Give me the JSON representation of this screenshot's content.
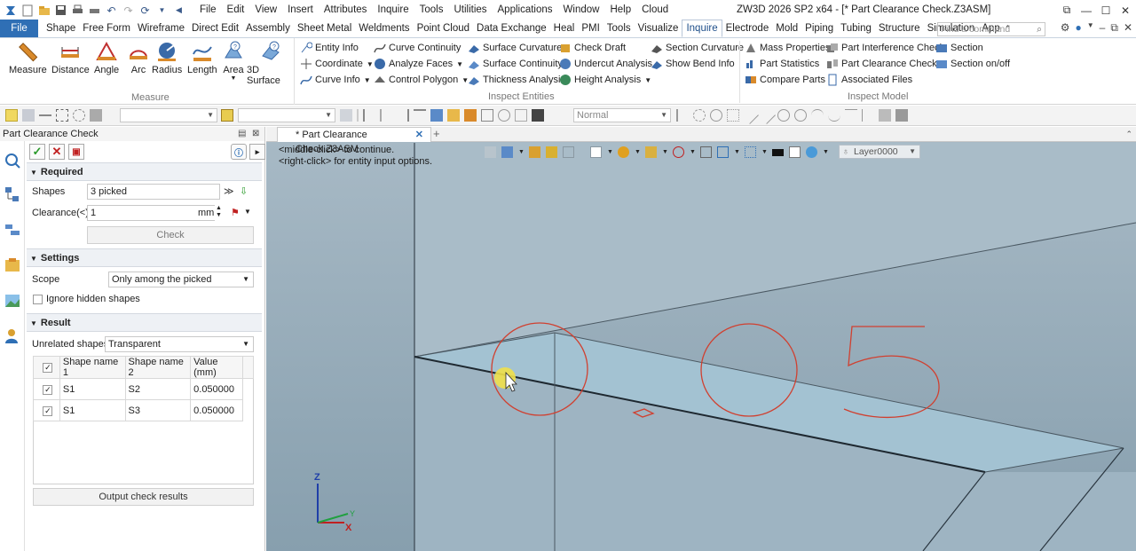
{
  "app": {
    "title": "ZW3D 2026 SP2 x64 - [* Part Clearance Check.Z3ASM]",
    "menu": [
      "File",
      "Edit",
      "View",
      "Insert",
      "Attributes",
      "Inquire",
      "Tools",
      "Utilities",
      "Applications",
      "Window",
      "Help",
      "Cloud"
    ]
  },
  "ribbon_tabs": [
    "Shape",
    "Free Form",
    "Wireframe",
    "Direct Edit",
    "Assembly",
    "Sheet Metal",
    "Weldments",
    "Point Cloud",
    "Data Exchange",
    "Heal",
    "PMI",
    "Tools",
    "Visualize",
    "Inquire",
    "Electrode",
    "Mold",
    "Piping",
    "Tubing",
    "Structure",
    "Simulation",
    "App"
  ],
  "file_tab": "File",
  "active_tab": "Inquire",
  "search": {
    "placeholder": "Find a command"
  },
  "measure_group": {
    "label": "Measure",
    "buttons": [
      "Measure",
      "Distance",
      "Angle",
      "Arc",
      "Radius",
      "Length",
      "Area",
      "3D Surface"
    ]
  },
  "inspect_entities": {
    "label": "Inspect Entities",
    "col1": [
      "Entity Info",
      "Coordinate",
      "Curve Info"
    ],
    "col2": [
      "Curve Continuity",
      "Analyze Faces",
      "Control Polygon"
    ],
    "col3": [
      "Surface Curvature",
      "Surface Continuity",
      "Thickness Analysis"
    ],
    "col4": [
      "Check Draft",
      "Undercut Analysis",
      "Height Analysis"
    ],
    "col5": [
      "Section Curvature",
      "Show Bend Info"
    ]
  },
  "inspect_model": {
    "label": "Inspect Model",
    "col1": [
      "Mass Properties",
      "Part Statistics",
      "Compare Parts"
    ],
    "col2": [
      "Part Interference Check",
      "Part Clearance Check",
      "Associated Files"
    ],
    "col3": [
      "Section",
      "Section on/off"
    ]
  },
  "toolbar": {
    "style_combo": "Normal"
  },
  "panel": {
    "title": "Part Clearance Check",
    "required": {
      "header": "Required",
      "shapes_label": "Shapes",
      "shapes_value": "3 picked",
      "clearance_label": "Clearance(<)",
      "clearance_value": "1",
      "clearance_unit": "mm",
      "check_button": "Check"
    },
    "settings": {
      "header": "Settings",
      "scope_label": "Scope",
      "scope_value": "Only among the picked",
      "ignore_hidden": "Ignore hidden shapes"
    },
    "result": {
      "header": "Result",
      "unrelated_label": "Unrelated shapes",
      "unrelated_value": "Transparent",
      "columns": [
        "Shape name 1",
        "Shape name 2",
        "Value (mm)"
      ],
      "rows": [
        {
          "shape1": "S1",
          "shape2": "S2",
          "value": "0.050000"
        },
        {
          "shape1": "S1",
          "shape2": "S3",
          "value": "0.050000"
        }
      ],
      "output_button": "Output check results"
    }
  },
  "viewport": {
    "tab_label": "* Part Clearance Check.Z3ASM",
    "hint_line1": "<middle-click> to continue.",
    "hint_line2": "<right-click> for entity input options.",
    "layer": "Layer0000",
    "axes": {
      "z": "Z",
      "y": "Y",
      "x": "X"
    }
  },
  "colors": {
    "accent": "#2f6fb5",
    "viewport_bg": "#8fa6b6",
    "annotation": "#d04030",
    "cursor_highlight": "#f0e04a"
  }
}
